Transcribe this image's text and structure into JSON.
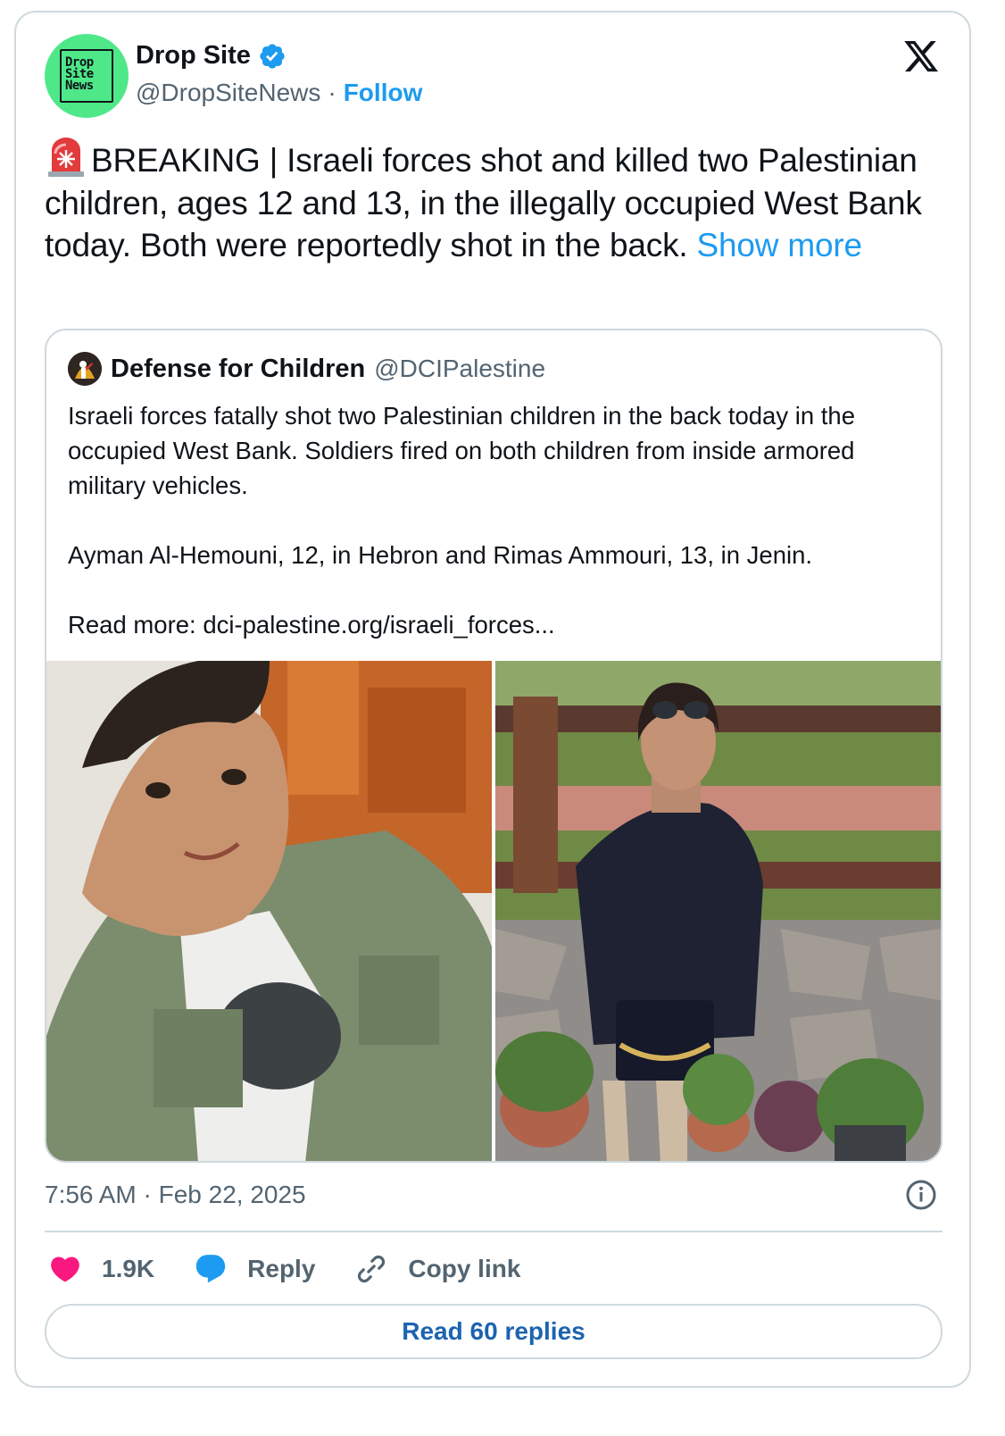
{
  "author": {
    "logo_text": "Drop\nSite\nNews",
    "display_name": "Drop Site",
    "handle": "@DropSiteNews",
    "separator": "·",
    "follow_label": "Follow"
  },
  "tweet": {
    "text": "BREAKING | Israeli forces shot and killed two Palestinian children, ages 12 and 13, in the illegally occupied West Bank today. Both were reportedly shot in the back.",
    "show_more_label": "Show more"
  },
  "quoted": {
    "display_name": "Defense for Children",
    "handle": "@DCIPalestine",
    "text": "Israeli forces fatally shot two Palestinian children in the back today in the occupied West Bank. Soldiers fired on both children from inside armored military vehicles.\n\nAyman Al-Hemouni, 12, in Hebron and Rimas Ammouri, 13, in Jenin.\n\nRead more: dci-palestine.org/israeli_forces..."
  },
  "meta": {
    "timestamp": "7:56 AM · Feb 22, 2025"
  },
  "actions": {
    "like_count": "1.9K",
    "reply_label": "Reply",
    "copy_link_label": "Copy link",
    "read_replies_label": "Read 60 replies"
  },
  "colors": {
    "accent": "#1d9bf0",
    "like": "#f91880",
    "avatar_bg": "#4ee889",
    "muted": "#536471"
  }
}
